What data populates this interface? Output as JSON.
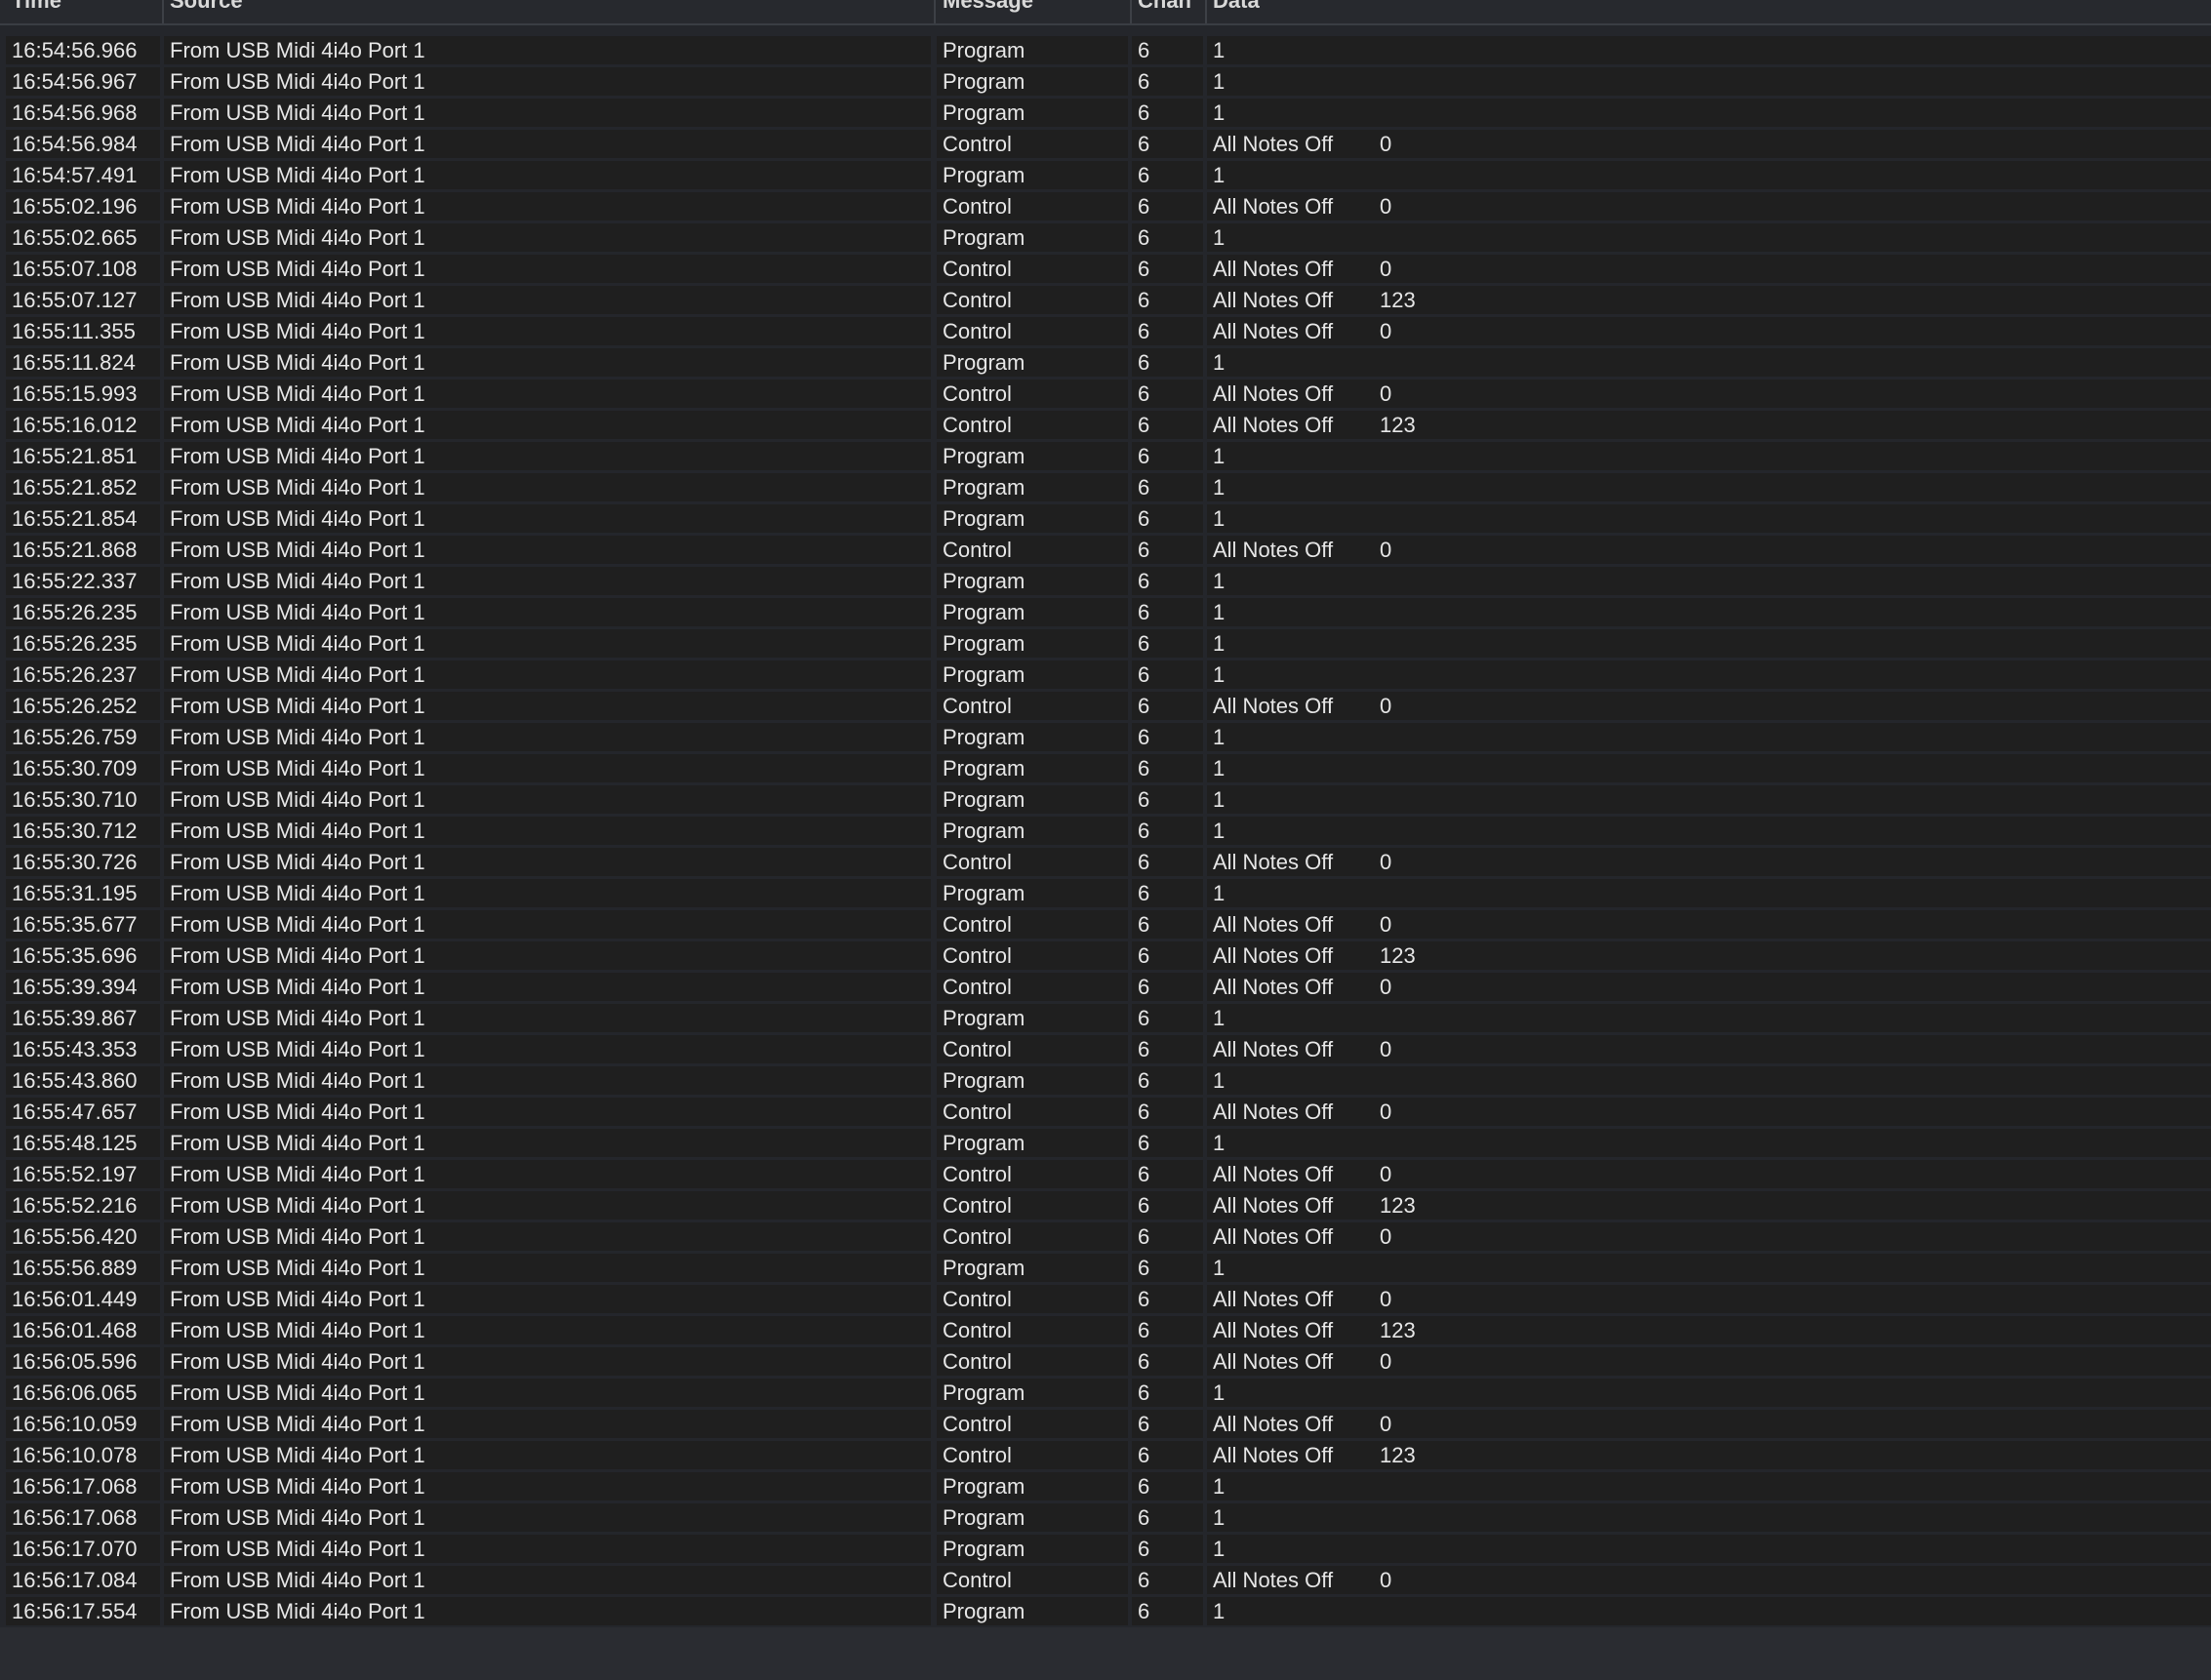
{
  "columns": {
    "time": "Time",
    "source": "Source",
    "message": "Message",
    "chan": "Chan",
    "data": "Data"
  },
  "rows": [
    {
      "time": "16:54:56.966",
      "source": "From USB Midi 4i4o Port 1",
      "message": "Program",
      "chan": "6",
      "data1": "1",
      "data2": ""
    },
    {
      "time": "16:54:56.967",
      "source": "From USB Midi 4i4o Port 1",
      "message": "Program",
      "chan": "6",
      "data1": "1",
      "data2": ""
    },
    {
      "time": "16:54:56.968",
      "source": "From USB Midi 4i4o Port 1",
      "message": "Program",
      "chan": "6",
      "data1": "1",
      "data2": ""
    },
    {
      "time": "16:54:56.984",
      "source": "From USB Midi 4i4o Port 1",
      "message": "Control",
      "chan": "6",
      "data1": "All Notes Off",
      "data2": "0"
    },
    {
      "time": "16:54:57.491",
      "source": "From USB Midi 4i4o Port 1",
      "message": "Program",
      "chan": "6",
      "data1": "1",
      "data2": ""
    },
    {
      "time": "16:55:02.196",
      "source": "From USB Midi 4i4o Port 1",
      "message": "Control",
      "chan": "6",
      "data1": "All Notes Off",
      "data2": "0"
    },
    {
      "time": "16:55:02.665",
      "source": "From USB Midi 4i4o Port 1",
      "message": "Program",
      "chan": "6",
      "data1": "1",
      "data2": ""
    },
    {
      "time": "16:55:07.108",
      "source": "From USB Midi 4i4o Port 1",
      "message": "Control",
      "chan": "6",
      "data1": "All Notes Off",
      "data2": "0"
    },
    {
      "time": "16:55:07.127",
      "source": "From USB Midi 4i4o Port 1",
      "message": "Control",
      "chan": "6",
      "data1": "All Notes Off",
      "data2": "123"
    },
    {
      "time": "16:55:11.355",
      "source": "From USB Midi 4i4o Port 1",
      "message": "Control",
      "chan": "6",
      "data1": "All Notes Off",
      "data2": "0"
    },
    {
      "time": "16:55:11.824",
      "source": "From USB Midi 4i4o Port 1",
      "message": "Program",
      "chan": "6",
      "data1": "1",
      "data2": ""
    },
    {
      "time": "16:55:15.993",
      "source": "From USB Midi 4i4o Port 1",
      "message": "Control",
      "chan": "6",
      "data1": "All Notes Off",
      "data2": "0"
    },
    {
      "time": "16:55:16.012",
      "source": "From USB Midi 4i4o Port 1",
      "message": "Control",
      "chan": "6",
      "data1": "All Notes Off",
      "data2": "123"
    },
    {
      "time": "16:55:21.851",
      "source": "From USB Midi 4i4o Port 1",
      "message": "Program",
      "chan": "6",
      "data1": "1",
      "data2": ""
    },
    {
      "time": "16:55:21.852",
      "source": "From USB Midi 4i4o Port 1",
      "message": "Program",
      "chan": "6",
      "data1": "1",
      "data2": ""
    },
    {
      "time": "16:55:21.854",
      "source": "From USB Midi 4i4o Port 1",
      "message": "Program",
      "chan": "6",
      "data1": "1",
      "data2": ""
    },
    {
      "time": "16:55:21.868",
      "source": "From USB Midi 4i4o Port 1",
      "message": "Control",
      "chan": "6",
      "data1": "All Notes Off",
      "data2": "0"
    },
    {
      "time": "16:55:22.337",
      "source": "From USB Midi 4i4o Port 1",
      "message": "Program",
      "chan": "6",
      "data1": "1",
      "data2": ""
    },
    {
      "time": "16:55:26.235",
      "source": "From USB Midi 4i4o Port 1",
      "message": "Program",
      "chan": "6",
      "data1": "1",
      "data2": ""
    },
    {
      "time": "16:55:26.235",
      "source": "From USB Midi 4i4o Port 1",
      "message": "Program",
      "chan": "6",
      "data1": "1",
      "data2": ""
    },
    {
      "time": "16:55:26.237",
      "source": "From USB Midi 4i4o Port 1",
      "message": "Program",
      "chan": "6",
      "data1": "1",
      "data2": ""
    },
    {
      "time": "16:55:26.252",
      "source": "From USB Midi 4i4o Port 1",
      "message": "Control",
      "chan": "6",
      "data1": "All Notes Off",
      "data2": "0"
    },
    {
      "time": "16:55:26.759",
      "source": "From USB Midi 4i4o Port 1",
      "message": "Program",
      "chan": "6",
      "data1": "1",
      "data2": ""
    },
    {
      "time": "16:55:30.709",
      "source": "From USB Midi 4i4o Port 1",
      "message": "Program",
      "chan": "6",
      "data1": "1",
      "data2": ""
    },
    {
      "time": "16:55:30.710",
      "source": "From USB Midi 4i4o Port 1",
      "message": "Program",
      "chan": "6",
      "data1": "1",
      "data2": ""
    },
    {
      "time": "16:55:30.712",
      "source": "From USB Midi 4i4o Port 1",
      "message": "Program",
      "chan": "6",
      "data1": "1",
      "data2": ""
    },
    {
      "time": "16:55:30.726",
      "source": "From USB Midi 4i4o Port 1",
      "message": "Control",
      "chan": "6",
      "data1": "All Notes Off",
      "data2": "0"
    },
    {
      "time": "16:55:31.195",
      "source": "From USB Midi 4i4o Port 1",
      "message": "Program",
      "chan": "6",
      "data1": "1",
      "data2": ""
    },
    {
      "time": "16:55:35.677",
      "source": "From USB Midi 4i4o Port 1",
      "message": "Control",
      "chan": "6",
      "data1": "All Notes Off",
      "data2": "0"
    },
    {
      "time": "16:55:35.696",
      "source": "From USB Midi 4i4o Port 1",
      "message": "Control",
      "chan": "6",
      "data1": "All Notes Off",
      "data2": "123"
    },
    {
      "time": "16:55:39.394",
      "source": "From USB Midi 4i4o Port 1",
      "message": "Control",
      "chan": "6",
      "data1": "All Notes Off",
      "data2": "0"
    },
    {
      "time": "16:55:39.867",
      "source": "From USB Midi 4i4o Port 1",
      "message": "Program",
      "chan": "6",
      "data1": "1",
      "data2": ""
    },
    {
      "time": "16:55:43.353",
      "source": "From USB Midi 4i4o Port 1",
      "message": "Control",
      "chan": "6",
      "data1": "All Notes Off",
      "data2": "0"
    },
    {
      "time": "16:55:43.860",
      "source": "From USB Midi 4i4o Port 1",
      "message": "Program",
      "chan": "6",
      "data1": "1",
      "data2": ""
    },
    {
      "time": "16:55:47.657",
      "source": "From USB Midi 4i4o Port 1",
      "message": "Control",
      "chan": "6",
      "data1": "All Notes Off",
      "data2": "0"
    },
    {
      "time": "16:55:48.125",
      "source": "From USB Midi 4i4o Port 1",
      "message": "Program",
      "chan": "6",
      "data1": "1",
      "data2": ""
    },
    {
      "time": "16:55:52.197",
      "source": "From USB Midi 4i4o Port 1",
      "message": "Control",
      "chan": "6",
      "data1": "All Notes Off",
      "data2": "0"
    },
    {
      "time": "16:55:52.216",
      "source": "From USB Midi 4i4o Port 1",
      "message": "Control",
      "chan": "6",
      "data1": "All Notes Off",
      "data2": "123"
    },
    {
      "time": "16:55:56.420",
      "source": "From USB Midi 4i4o Port 1",
      "message": "Control",
      "chan": "6",
      "data1": "All Notes Off",
      "data2": "0"
    },
    {
      "time": "16:55:56.889",
      "source": "From USB Midi 4i4o Port 1",
      "message": "Program",
      "chan": "6",
      "data1": "1",
      "data2": ""
    },
    {
      "time": "16:56:01.449",
      "source": "From USB Midi 4i4o Port 1",
      "message": "Control",
      "chan": "6",
      "data1": "All Notes Off",
      "data2": "0"
    },
    {
      "time": "16:56:01.468",
      "source": "From USB Midi 4i4o Port 1",
      "message": "Control",
      "chan": "6",
      "data1": "All Notes Off",
      "data2": "123"
    },
    {
      "time": "16:56:05.596",
      "source": "From USB Midi 4i4o Port 1",
      "message": "Control",
      "chan": "6",
      "data1": "All Notes Off",
      "data2": "0"
    },
    {
      "time": "16:56:06.065",
      "source": "From USB Midi 4i4o Port 1",
      "message": "Program",
      "chan": "6",
      "data1": "1",
      "data2": ""
    },
    {
      "time": "16:56:10.059",
      "source": "From USB Midi 4i4o Port 1",
      "message": "Control",
      "chan": "6",
      "data1": "All Notes Off",
      "data2": "0"
    },
    {
      "time": "16:56:10.078",
      "source": "From USB Midi 4i4o Port 1",
      "message": "Control",
      "chan": "6",
      "data1": "All Notes Off",
      "data2": "123"
    },
    {
      "time": "16:56:17.068",
      "source": "From USB Midi 4i4o Port 1",
      "message": "Program",
      "chan": "6",
      "data1": "1",
      "data2": ""
    },
    {
      "time": "16:56:17.068",
      "source": "From USB Midi 4i4o Port 1",
      "message": "Program",
      "chan": "6",
      "data1": "1",
      "data2": ""
    },
    {
      "time": "16:56:17.070",
      "source": "From USB Midi 4i4o Port 1",
      "message": "Program",
      "chan": "6",
      "data1": "1",
      "data2": ""
    },
    {
      "time": "16:56:17.084",
      "source": "From USB Midi 4i4o Port 1",
      "message": "Control",
      "chan": "6",
      "data1": "All Notes Off",
      "data2": "0"
    },
    {
      "time": "16:56:17.554",
      "source": "From USB Midi 4i4o Port 1",
      "message": "Program",
      "chan": "6",
      "data1": "1",
      "data2": ""
    }
  ]
}
